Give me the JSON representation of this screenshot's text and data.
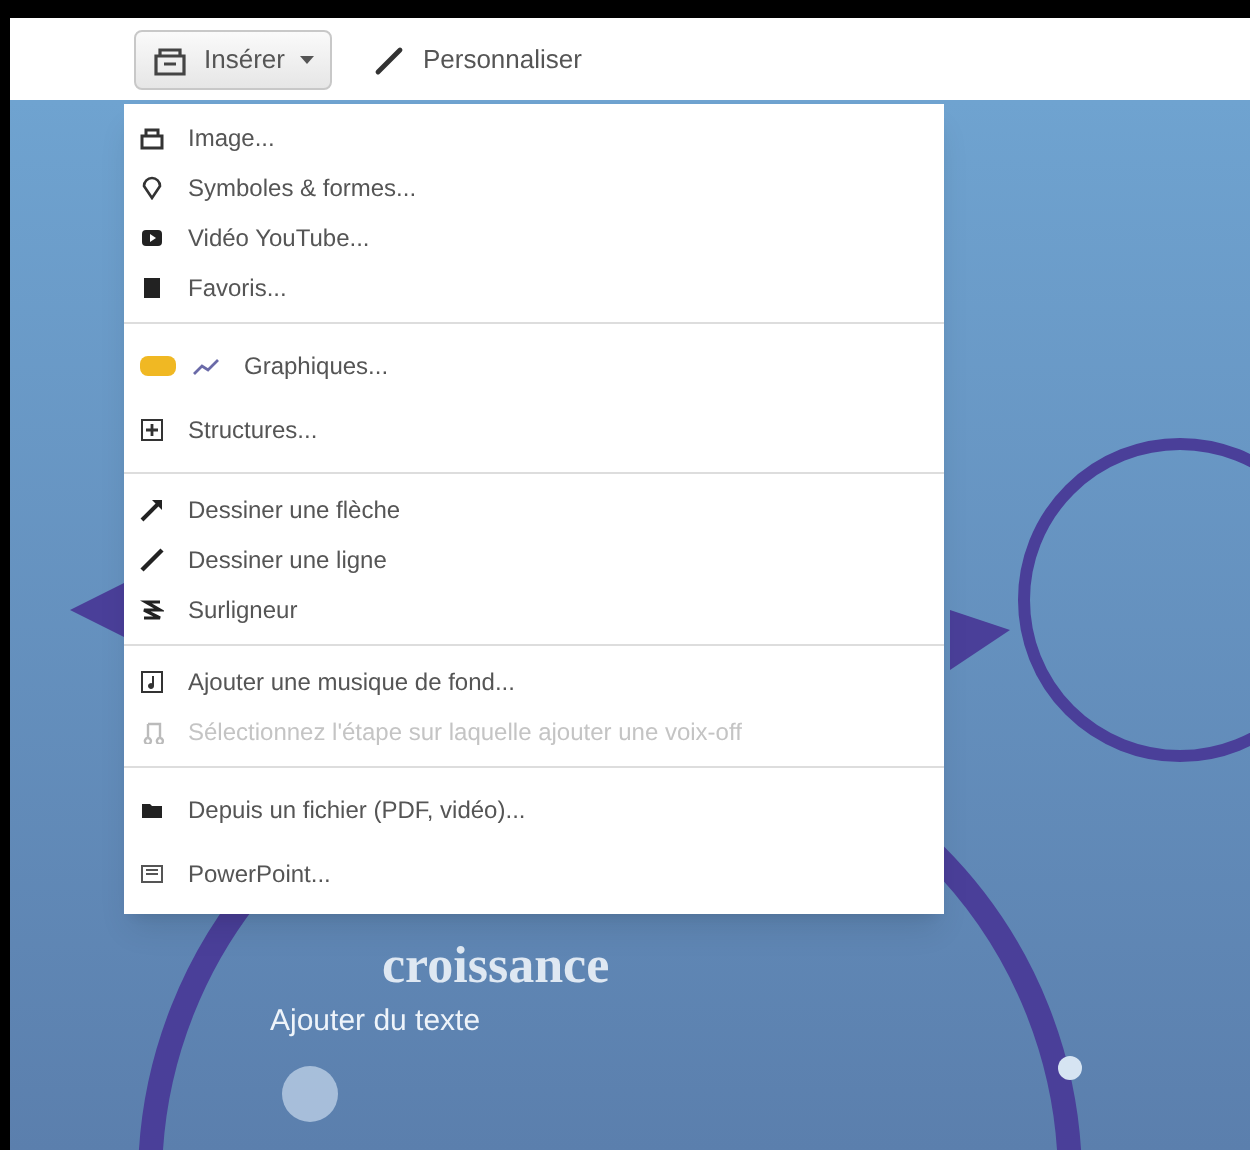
{
  "toolbar": [
    {
      "kind": "insert",
      "label": "Insérer",
      "selected": true
    },
    {
      "kind": "customize",
      "label": "Personnaliser",
      "selected": false
    }
  ],
  "menu": {
    "groups": [
      {
        "items": [
          {
            "kind": "image",
            "label": "Image...",
            "disabled": false
          },
          {
            "kind": "symbols",
            "label": "Symboles & formes...",
            "disabled": false
          },
          {
            "kind": "video",
            "label": "Vidéo YouTube...",
            "disabled": false
          },
          {
            "kind": "favorites",
            "label": "Favoris...",
            "disabled": false
          }
        ]
      },
      {
        "items": [
          {
            "kind": "chart",
            "label": "Graphiques...",
            "disabled": false,
            "badge": true
          },
          {
            "kind": "structure",
            "label": "Structures...",
            "disabled": false
          }
        ]
      },
      {
        "items": [
          {
            "kind": "arrow",
            "label": "Dessiner une flèche",
            "disabled": false
          },
          {
            "kind": "line",
            "label": "Dessiner une ligne",
            "disabled": false
          },
          {
            "kind": "highlighter",
            "label": "Surligneur",
            "disabled": false
          }
        ]
      },
      {
        "items": [
          {
            "kind": "music",
            "label": "Ajouter une musique de fond...",
            "disabled": false
          },
          {
            "kind": "voice",
            "label": "Sélectionnez l'étape sur laquelle ajouter une voix-off",
            "disabled": true
          }
        ]
      },
      {
        "items": [
          {
            "kind": "file",
            "label": "Depuis un fichier (PDF, vidéo)...",
            "disabled": false
          },
          {
            "kind": "powerpoint",
            "label": "PowerPoint...",
            "disabled": false
          }
        ]
      }
    ]
  },
  "canvas": {
    "title": "croissance",
    "subtitle": "Ajouter du texte"
  }
}
